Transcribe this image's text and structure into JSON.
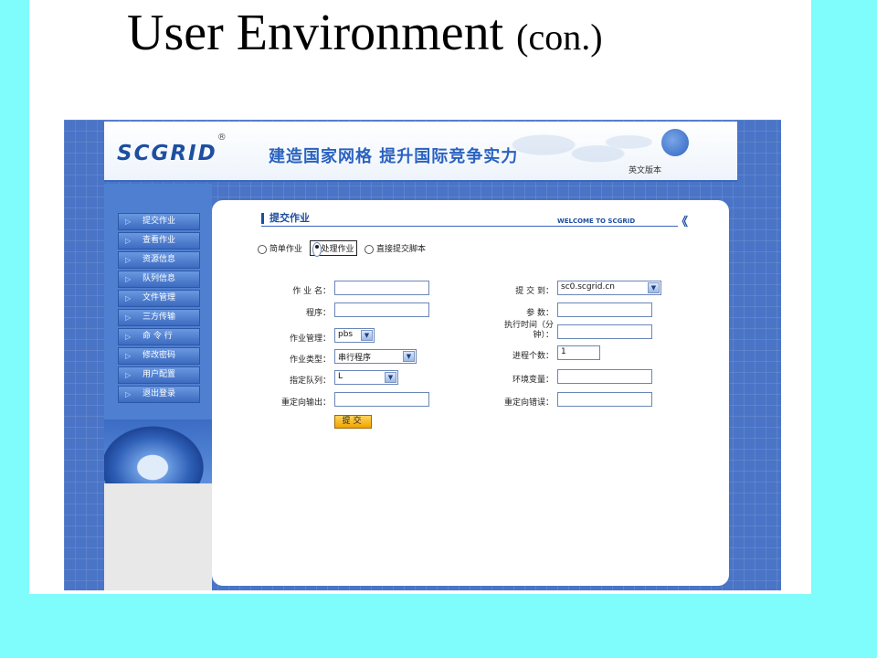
{
  "slide": {
    "title": "User Environment",
    "title_suffix": "(con.)"
  },
  "header": {
    "logo_text": "SCGRID",
    "logo_reg": "®",
    "slogan": "建造国家网格 提升国际竞争实力",
    "lang_link": "英文版本"
  },
  "sidebar": {
    "items": [
      {
        "label": "提交作业"
      },
      {
        "label": "查看作业"
      },
      {
        "label": "资源信息"
      },
      {
        "label": "队列信息"
      },
      {
        "label": "文件管理"
      },
      {
        "label": "三方传输"
      },
      {
        "label": "命 令 行"
      },
      {
        "label": "修改密码"
      },
      {
        "label": "用户配置"
      },
      {
        "label": "退出登录"
      }
    ],
    "arrow_glyph": "▷"
  },
  "panel": {
    "title": "提交作业",
    "welcome": "WELCOME TO SCGRID",
    "chevron": "《"
  },
  "job_type": {
    "options": [
      "简单作业",
      "批处理作业",
      "直接提交脚本"
    ],
    "selected": "批处理作业"
  },
  "form": {
    "job_name_label": "作 业 名：",
    "program_label": "程序：",
    "job_manager_label": "作业管理：",
    "job_manager_value": "pbs",
    "job_kind_label": "作业类型：",
    "job_kind_value": "串行程序",
    "queue_label": "指定队列：",
    "queue_value": "L",
    "redirect_out_label": "重定向输出：",
    "submit_to_label": "提 交 到：",
    "submit_to_value": "sc0.scgrid.cn",
    "params_label": "参 数：",
    "exec_time_label": "执行时间（分钟）：",
    "exec_time_label_line1": "执行时间（分",
    "exec_time_label_line2": "钟）：",
    "process_count_label": "进程个数：",
    "process_count_value": "1",
    "env_vars_label": "环境变量：",
    "redirect_err_label": "重定向错误：",
    "submit_label": "提交"
  },
  "colors": {
    "page_bg": "#7ffcfc",
    "frame_blue": "#4a74c6",
    "brand_blue": "#1d4fa0",
    "submit_orange": "#f0a400"
  }
}
